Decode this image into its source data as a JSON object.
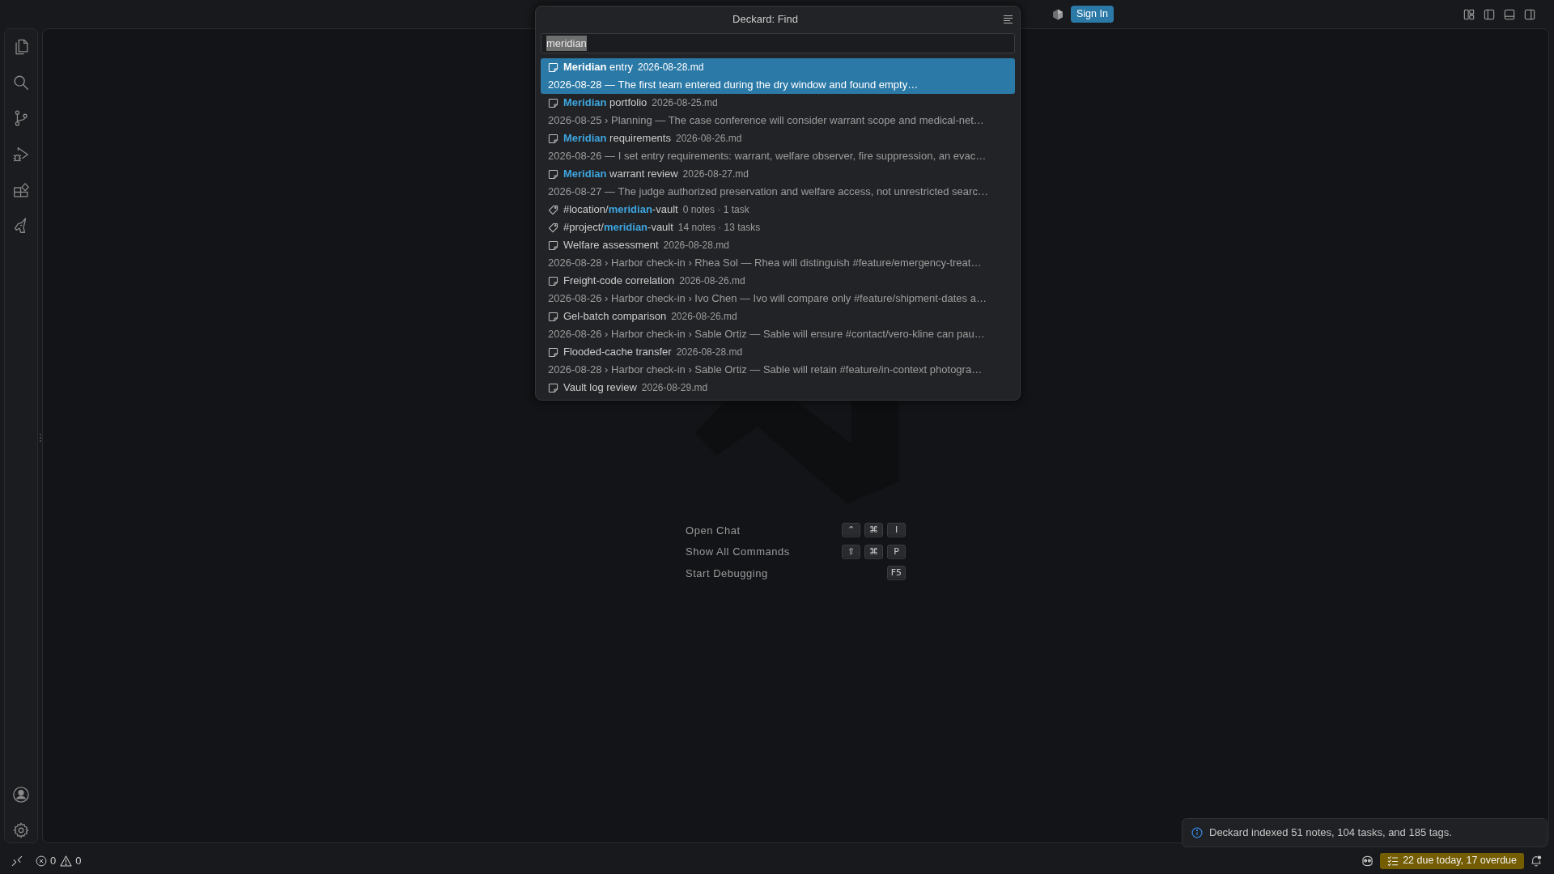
{
  "title_bar": {
    "sign_in_button": "Sign In"
  },
  "quick_pick": {
    "title": "Deckard: Find",
    "search": {
      "value": "meridian",
      "text_selected": true
    },
    "items": [
      {
        "kind": "note",
        "label": "**Meridian** entry",
        "description": "2026-08-28.md",
        "detail": "2026-08-28 — The first team entered during the dry window and found empty…",
        "selected": true
      },
      {
        "kind": "note",
        "label": "**Meridian** portfolio",
        "description": "2026-08-25.md",
        "detail": "2026-08-25 › Planning — The case conference will consider warrant scope and medical-net…",
        "selected": false
      },
      {
        "kind": "note",
        "label": "**Meridian** requirements",
        "description": "2026-08-26.md",
        "detail": "2026-08-26 — I set entry requirements: warrant, welfare observer, fire suppression, an evac…",
        "selected": false
      },
      {
        "kind": "note",
        "label": "**Meridian** warrant review",
        "description": "2026-08-27.md",
        "detail": "2026-08-27 — The judge authorized preservation and welfare access, not unrestricted searc…",
        "selected": false
      },
      {
        "kind": "tag",
        "label": "#location/**meridian**-vault",
        "description": "0 notes · 1 task",
        "selected": false
      },
      {
        "kind": "tag",
        "label": "#project/**meridian**-vault",
        "description": "14 notes · 13 tasks",
        "selected": false
      },
      {
        "kind": "note",
        "label": "Welfare assessment",
        "description": "2026-08-28.md",
        "detail": "2026-08-28 › Harbor check-in › Rhea Sol — Rhea will distinguish #feature/emergency-treat…",
        "selected": false
      },
      {
        "kind": "note",
        "label": "Freight-code correlation",
        "description": "2026-08-26.md",
        "detail": "2026-08-26 › Harbor check-in › Ivo Chen — Ivo will compare only #feature/shipment-dates a…",
        "selected": false
      },
      {
        "kind": "note",
        "label": "Gel-batch comparison",
        "description": "2026-08-26.md",
        "detail": "2026-08-26 › Harbor check-in › Sable Ortiz — Sable will ensure #contact/vero-kline can pau…",
        "selected": false
      },
      {
        "kind": "note",
        "label": "Flooded-cache transfer",
        "description": "2026-08-28.md",
        "detail": "2026-08-28 › Harbor check-in › Sable Ortiz — Sable will retain #feature/in-context photogra…",
        "selected": false
      },
      {
        "kind": "note",
        "label": "Vault log review",
        "description": "2026-08-29.md",
        "selected": false
      }
    ]
  },
  "welcome": {
    "commands": [
      {
        "label": "Open Chat",
        "keys": [
          "⌃",
          "⌘",
          "I"
        ]
      },
      {
        "label": "Show All Commands",
        "keys": [
          "⇧",
          "⌘",
          "P"
        ]
      },
      {
        "label": "Start Debugging",
        "keys": [
          "F5"
        ]
      }
    ]
  },
  "notification": {
    "message": "Deckard indexed 51 notes, 104 tasks, and 185 tags."
  },
  "status_bar": {
    "errors": "0",
    "warnings": "0",
    "tasks": "22 due today, 17 overdue"
  }
}
